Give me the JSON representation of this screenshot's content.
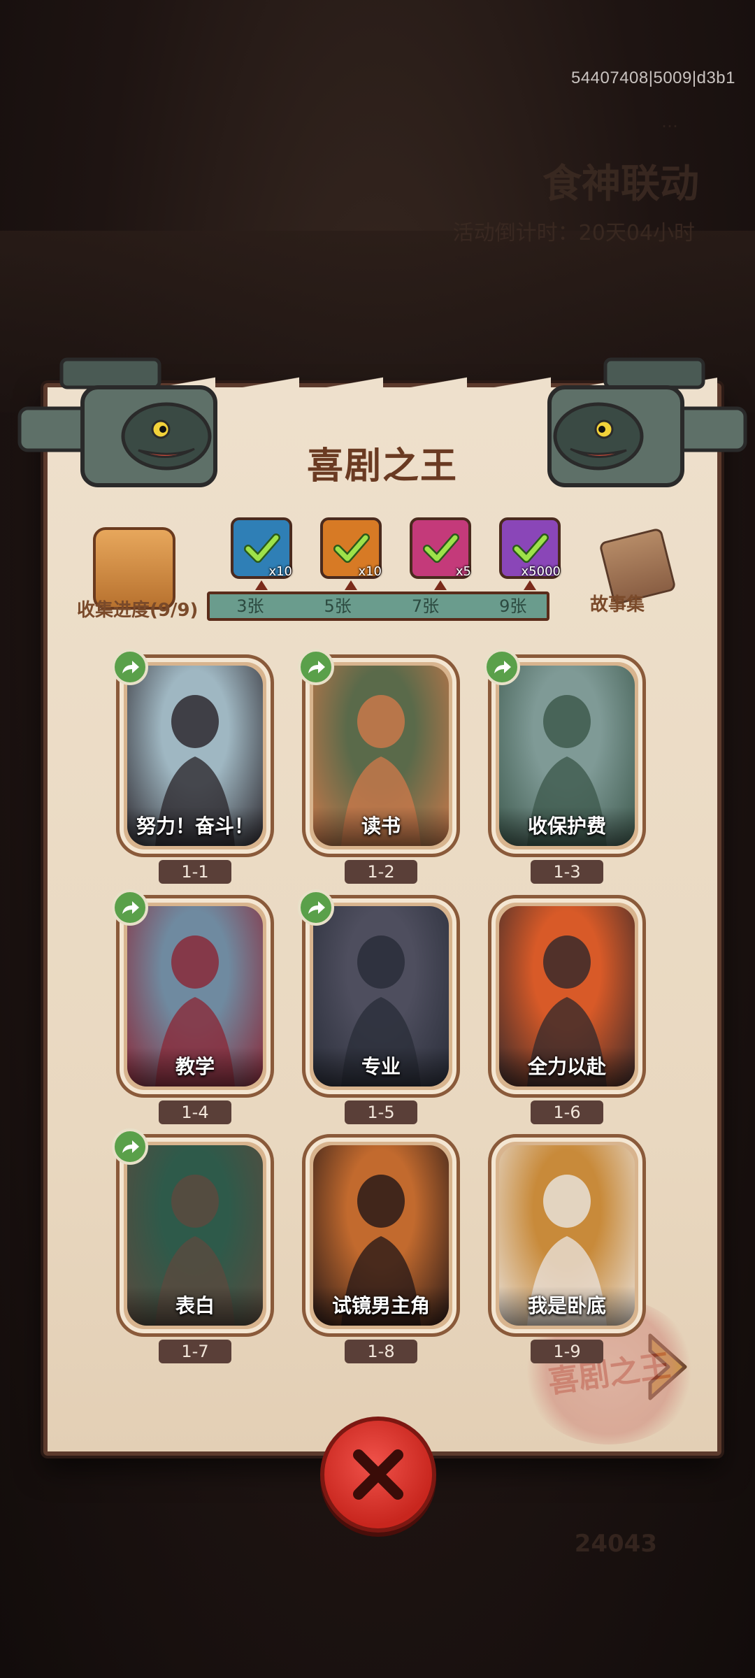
{
  "debug_id": "54407408|5009|d3b1",
  "background": {
    "event_subtitle": "…",
    "event_title": "食神联动",
    "countdown": "活动倒计时：20天04小时",
    "count": "24043"
  },
  "panel": {
    "title": "喜剧之王",
    "collect_label": "收集进度(9/9)",
    "story_label": "故事集",
    "progress_marks": [
      "3张",
      "5张",
      "7张",
      "9张"
    ],
    "rewards": [
      {
        "icon": "blue-gem-chest-icon",
        "count": "x10",
        "color": "#2f7fb6"
      },
      {
        "icon": "orange-ticket-icon",
        "count": "x10",
        "color": "#d77a25"
      },
      {
        "icon": "purple-orb-icon",
        "count": "x5",
        "color": "#c43a7a"
      },
      {
        "icon": "purple-card-icon",
        "count": "x5000",
        "color": "#8a46b8"
      }
    ],
    "stamp_text": "喜剧之王"
  },
  "cards": [
    {
      "caption": "努力！奋斗！",
      "number": "1-1",
      "shared": true,
      "palette": [
        "#9fb7c2",
        "#2e2a30"
      ]
    },
    {
      "caption": "读书",
      "number": "1-2",
      "shared": true,
      "palette": [
        "#5a6a4a",
        "#c9784a"
      ]
    },
    {
      "caption": "收保护费",
      "number": "1-3",
      "shared": true,
      "palette": [
        "#7f9a96",
        "#3e5a4e"
      ]
    },
    {
      "caption": "教学",
      "number": "1-4",
      "shared": true,
      "palette": [
        "#6f8aa0",
        "#8a2a3a"
      ]
    },
    {
      "caption": "专业",
      "number": "1-5",
      "shared": true,
      "palette": [
        "#4e4e5e",
        "#2a2e3a"
      ]
    },
    {
      "caption": "全力以赴",
      "number": "1-6",
      "shared": false,
      "palette": [
        "#d85a28",
        "#3a2a2a"
      ]
    },
    {
      "caption": "表白",
      "number": "1-7",
      "shared": true,
      "palette": [
        "#2e5a4a",
        "#5a4a3e"
      ]
    },
    {
      "caption": "试镜男主角",
      "number": "1-8",
      "shared": false,
      "palette": [
        "#c26a2e",
        "#2a1a18"
      ]
    },
    {
      "caption": "我是卧底",
      "number": "1-9",
      "shared": false,
      "palette": [
        "#c88a3a",
        "#e8e0d8"
      ]
    }
  ],
  "close_icon": "close-x-icon"
}
